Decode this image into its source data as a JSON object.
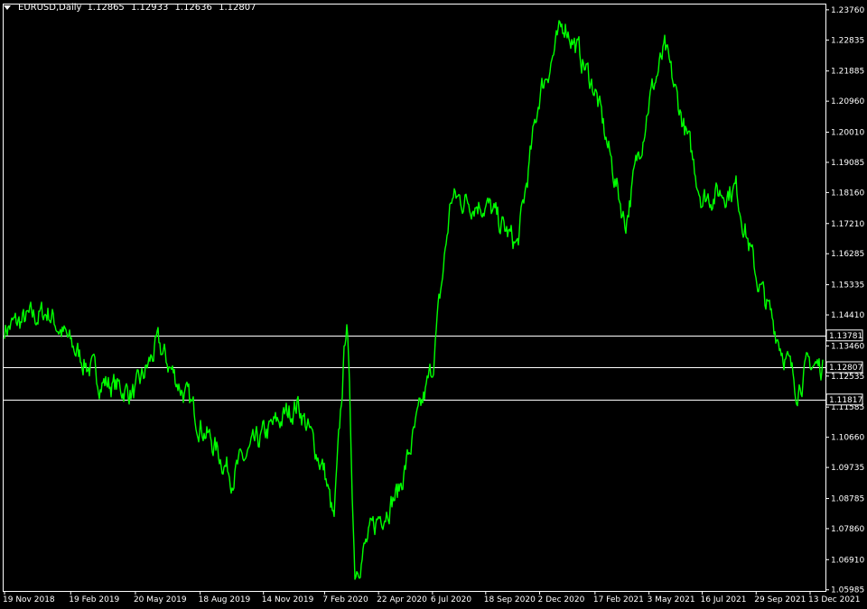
{
  "header": {
    "symbol": "EURUSD,Daily",
    "open": "1.12865",
    "high": "1.12933",
    "low": "1.12636",
    "close": "1.12807"
  },
  "colors": {
    "background": "#000000",
    "price_line": "#00ff00",
    "axis": "#ffffff",
    "hline": "#ffffff",
    "label_bg": "#000000"
  },
  "chart_data": {
    "type": "line",
    "x_tick_labels": [
      "19 Nov 2018",
      "19 Feb 2019",
      "20 May 2019",
      "18 Aug 2019",
      "14 Nov 2019",
      "7 Feb 2020",
      "22 Apr 2020",
      "6 Jul 2020",
      "18 Sep 2020",
      "2 Dec 2020",
      "17 Feb 2021",
      "3 May 2021",
      "16 Jul 2021",
      "29 Sep 2021",
      "13 Dec 2021"
    ],
    "y_tick_labels": [
      "1.23760",
      "1.22835",
      "1.21885",
      "1.20960",
      "1.20010",
      "1.19085",
      "1.18160",
      "1.17210",
      "1.16285",
      "1.15335",
      "1.14410",
      "1.13460",
      "1.12535",
      "1.11585",
      "1.10660",
      "1.09735",
      "1.08785",
      "1.07860",
      "1.06910",
      "1.05985"
    ],
    "ylim": [
      1.0595,
      1.2395
    ],
    "horizontal_lines": [
      {
        "label": "1.13781",
        "value": 1.13781
      },
      {
        "label": "1.12807",
        "value": 1.12807
      },
      {
        "label": "1.11817",
        "value": 1.11817
      }
    ],
    "series": [
      {
        "x": [
          "19 Nov 2018",
          "19 Jan 2019",
          "19 Feb 2019",
          "1 Apr 2019",
          "20 May 2019",
          "20 Jun 2019",
          "18 Aug 2019",
          "1 Oct 2019",
          "14 Nov 2019",
          "1 Jan 2020",
          "7 Feb 2020",
          "20 Feb 2020",
          "9 Mar 2020",
          "20 Mar 2020",
          "22 Apr 2020",
          "20 May 2020",
          "6 Jul 2020",
          "1 Aug 2020",
          "18 Sep 2020",
          "1 Nov 2020",
          "2 Dec 2020",
          "6 Jan 2021",
          "17 Feb 2021",
          "31 Mar 2021",
          "3 May 2021",
          "25 May 2021",
          "16 Jul 2021",
          "1 Sep 2021",
          "29 Sep 2021",
          "24 Nov 2021",
          "13 Dec 2021",
          "31 Dec 2021"
        ],
        "values": [
          1.14,
          1.145,
          1.135,
          1.124,
          1.12,
          1.135,
          1.111,
          1.095,
          1.107,
          1.117,
          1.096,
          1.08,
          1.145,
          1.066,
          1.082,
          1.09,
          1.128,
          1.18,
          1.178,
          1.165,
          1.212,
          1.234,
          1.213,
          1.172,
          1.21,
          1.225,
          1.18,
          1.183,
          1.156,
          1.122,
          1.129,
          1.128
        ]
      }
    ]
  }
}
